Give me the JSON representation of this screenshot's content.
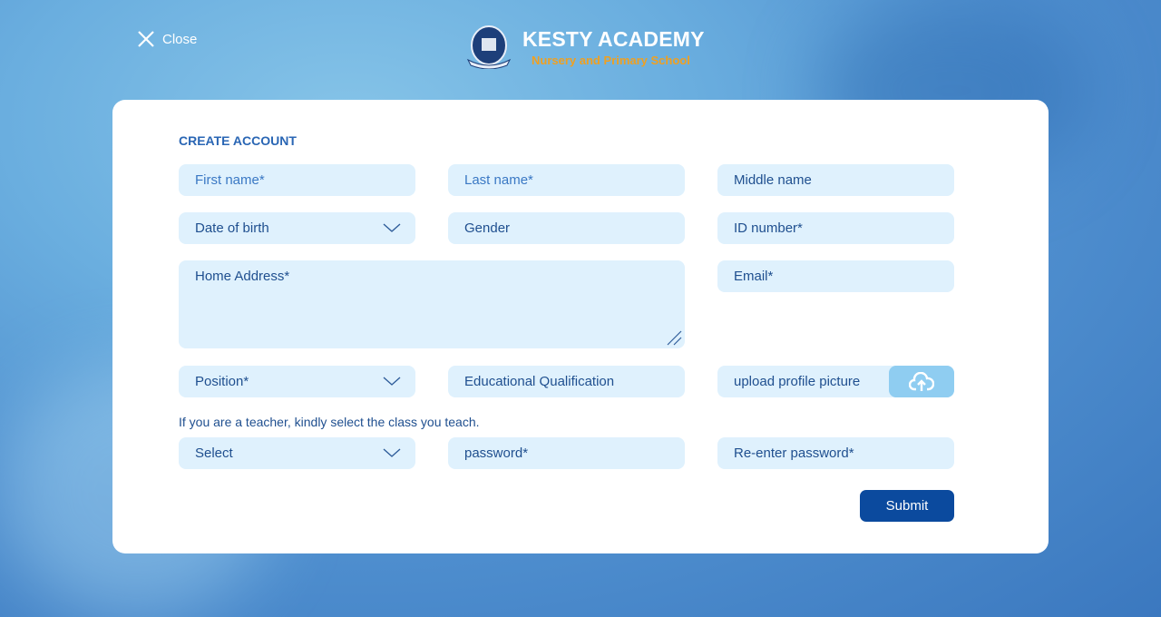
{
  "header": {
    "close_label": "Close",
    "brand_name": "KESTY ACADEMY",
    "brand_subtitle": "Nursery and Primary School"
  },
  "form": {
    "title": "CREATE ACCOUNT",
    "first_name": "First name*",
    "last_name": "Last name*",
    "middle_name": "Middle name",
    "date_of_birth": "Date of birth",
    "gender": "Gender",
    "id_number": "ID number*",
    "home_address": "Home Address*",
    "email": "Email*",
    "position": "Position*",
    "education": "Educational Qualification",
    "upload": "upload profile picture",
    "teacher_note": "If you are a teacher, kindly select the class you teach.",
    "class_select": "Select",
    "password": "password*",
    "reenter_password": "Re-enter password*",
    "submit": "Submit"
  },
  "colors": {
    "accent": "#0b4a9e",
    "field_bg": "#dff1fd",
    "brand_subtitle": "#f0a020"
  }
}
